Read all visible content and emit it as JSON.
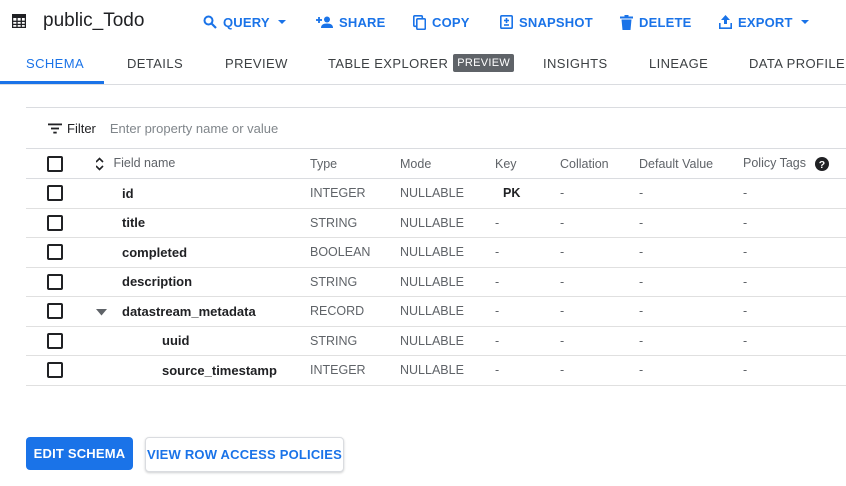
{
  "header": {
    "title": "public_Todo",
    "actions": [
      {
        "label": "QUERY",
        "icon": "search-icon"
      },
      {
        "label": "SHARE",
        "icon": "person-add-icon"
      },
      {
        "label": "COPY",
        "icon": "copy-icon"
      },
      {
        "label": "SNAPSHOT",
        "icon": "snapshot-icon"
      },
      {
        "label": "DELETE",
        "icon": "trash-icon"
      },
      {
        "label": "EXPORT",
        "icon": "upload-icon"
      }
    ]
  },
  "tabs": [
    {
      "label": "SCHEMA",
      "active": true
    },
    {
      "label": "DETAILS"
    },
    {
      "label": "PREVIEW"
    },
    {
      "label": "TABLE EXPLORER",
      "badge": "PREVIEW"
    },
    {
      "label": "INSIGHTS"
    },
    {
      "label": "LINEAGE"
    },
    {
      "label": "DATA PROFILE"
    }
  ],
  "filter": {
    "label": "Filter",
    "placeholder": "Enter property name or value"
  },
  "table": {
    "columns": [
      "Field name",
      "Type",
      "Mode",
      "Key",
      "Collation",
      "Default Value",
      "Policy Tags"
    ],
    "rows": [
      {
        "name": "id",
        "type": "INTEGER",
        "mode": "NULLABLE",
        "key": "PK",
        "collation": "-",
        "default": "-",
        "policy": "-"
      },
      {
        "name": "title",
        "type": "STRING",
        "mode": "NULLABLE",
        "key": "-",
        "collation": "-",
        "default": "-",
        "policy": "-"
      },
      {
        "name": "completed",
        "type": "BOOLEAN",
        "mode": "NULLABLE",
        "key": "-",
        "collation": "-",
        "default": "-",
        "policy": "-"
      },
      {
        "name": "description",
        "type": "STRING",
        "mode": "NULLABLE",
        "key": "-",
        "collation": "-",
        "default": "-",
        "policy": "-"
      },
      {
        "name": "datastream_metadata",
        "type": "RECORD",
        "mode": "NULLABLE",
        "key": "-",
        "collation": "-",
        "default": "-",
        "policy": "-"
      },
      {
        "name": "uuid",
        "type": "STRING",
        "mode": "NULLABLE",
        "key": "-",
        "collation": "-",
        "default": "-",
        "policy": "-"
      },
      {
        "name": "source_timestamp",
        "type": "INTEGER",
        "mode": "NULLABLE",
        "key": "-",
        "collation": "-",
        "default": "-",
        "policy": "-"
      }
    ]
  },
  "buttons": {
    "edit_schema": "EDIT SCHEMA",
    "row_access": "VIEW ROW ACCESS POLICIES"
  },
  "colors": {
    "accent": "#1a73e8",
    "text": "#202124",
    "muted": "#5f6368"
  }
}
